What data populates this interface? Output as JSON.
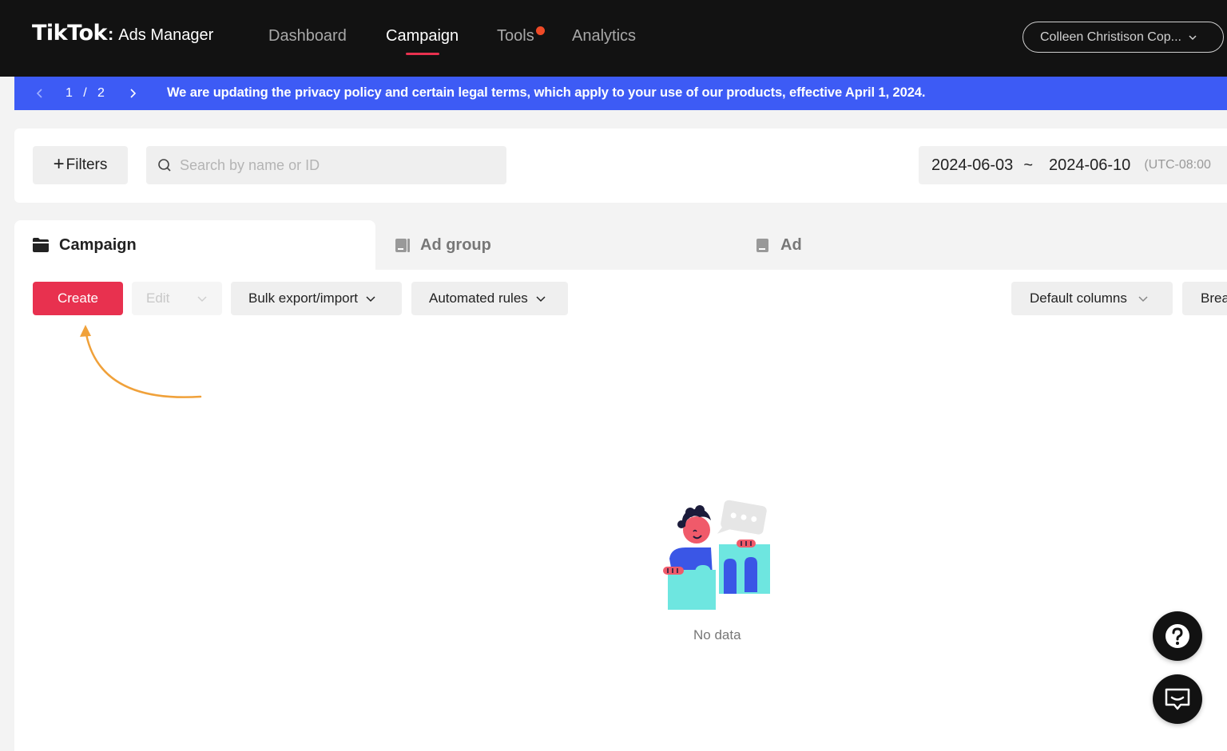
{
  "header": {
    "logo_main": "TikTok",
    "logo_colon": ":",
    "logo_sub": "Ads Manager",
    "nav": [
      {
        "label": "Dashboard",
        "active": false
      },
      {
        "label": "Campaign",
        "active": true
      },
      {
        "label": "Tools",
        "active": false,
        "has_dot": true
      },
      {
        "label": "Analytics",
        "active": false
      }
    ],
    "account_label": "Colleen Christison Cop..."
  },
  "banner": {
    "page_current": "1",
    "page_sep": "/",
    "page_total": "2",
    "message": "We are updating the privacy policy and certain legal terms, which apply to your use of our products, effective April 1, 2024."
  },
  "filters": {
    "filters_label": "Filters",
    "search_placeholder": "Search by name or ID",
    "date_start": "2024-06-03",
    "date_sep": "~",
    "date_end": "2024-06-10",
    "timezone": "(UTC-08:00"
  },
  "tabs": [
    {
      "label": "Campaign",
      "icon": "folder-icon",
      "active": true
    },
    {
      "label": "Ad group",
      "icon": "adgroup-icon",
      "active": false
    },
    {
      "label": "Ad",
      "icon": "ad-icon",
      "active": false
    }
  ],
  "toolbar": {
    "create_label": "Create",
    "edit_label": "Edit",
    "bulk_label": "Bulk export/import",
    "automated_label": "Automated rules",
    "columns_label": "Default columns",
    "breakdown_label": "Brea"
  },
  "empty_state": {
    "text": "No data"
  },
  "colors": {
    "nav_bg": "#121212",
    "accent": "#e8314f",
    "banner_bg": "#3d5bf5",
    "annotation_arrow": "#f0a13a"
  },
  "floating": {
    "help_icon": "question-icon",
    "chat_icon": "chat-icon"
  }
}
